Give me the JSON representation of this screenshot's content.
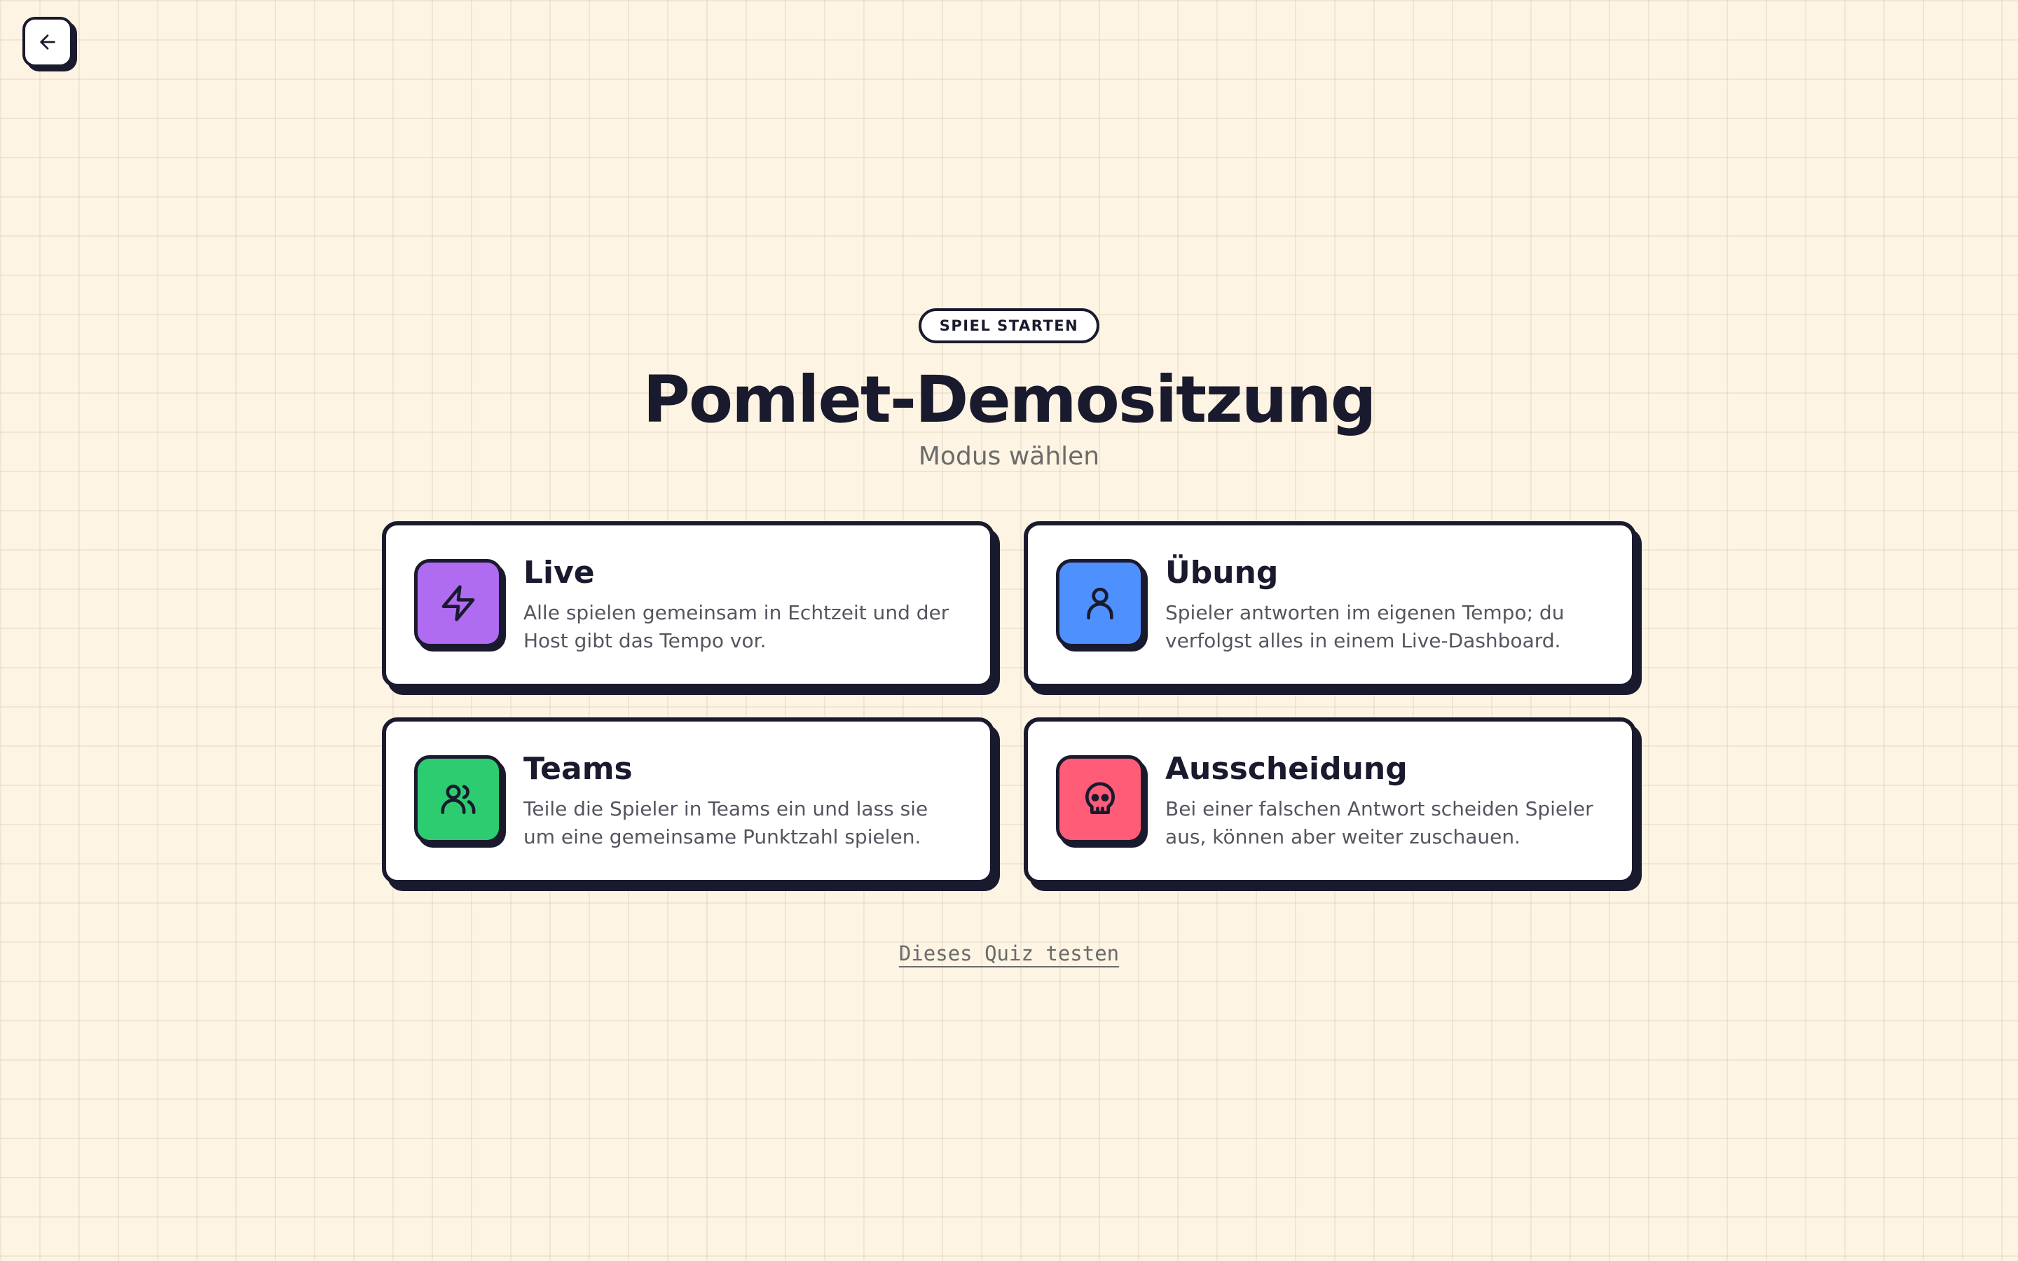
{
  "nav": {
    "back_icon": "arrow-left-icon"
  },
  "header": {
    "badge": "SPIEL STARTEN",
    "title": "Pomlet-Demositzung",
    "subtitle": "Modus wählen"
  },
  "modes": [
    {
      "title": "Live",
      "description": "Alle spielen gemeinsam in Echtzeit und der Host gibt das Tempo vor.",
      "icon": "lightning-icon",
      "color": "#b06cf0"
    },
    {
      "title": "Übung",
      "description": "Spieler antworten im eigenen Tempo; du verfolgst alles in einem Live-Dashboard.",
      "icon": "user-icon",
      "color": "#4d90fe"
    },
    {
      "title": "Teams",
      "description": "Teile die Spieler in Teams ein und lass sie um eine gemeinsame Punktzahl spielen.",
      "icon": "users-icon",
      "color": "#2ecc71"
    },
    {
      "title": "Ausscheidung",
      "description": "Bei einer falschen Antwort scheiden Spieler aus, können aber weiter zuschauen.",
      "icon": "skull-icon",
      "color": "#ff5c77"
    }
  ],
  "footer": {
    "test_link": "Dieses Quiz testen"
  }
}
